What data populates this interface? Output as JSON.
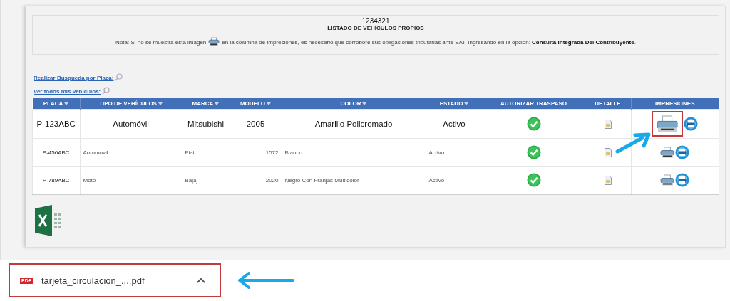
{
  "header": {
    "code": "1234321",
    "title": "LISTADO DE VEHÍCULOS PROPIOS",
    "note_before": "Nota: Si no se muestra esta imagen",
    "note_after": "en la columna de impresiones, es necesario que corrobore sus obligaciones tributarias ante SAT, ingresando en la opción: **Consulta Integrada Del Contribuyente**."
  },
  "links": [
    "Realizar Busqueda por Placa:",
    "Ver todos mis vehículos:"
  ],
  "table": {
    "columns": [
      {
        "label": "PLACA",
        "sortable": true
      },
      {
        "label": "TIPO DE VEHÍCULOS",
        "sortable": true
      },
      {
        "label": "MARCA",
        "sortable": true
      },
      {
        "label": "MODELO",
        "sortable": true
      },
      {
        "label": "COLOR",
        "sortable": true
      },
      {
        "label": "ESTADO",
        "sortable": true
      },
      {
        "label": "AUTORIZAR TRASPASO",
        "sortable": false
      },
      {
        "label": "DETALLE",
        "sortable": false
      },
      {
        "label": "IMPRESIONES",
        "sortable": false
      }
    ],
    "rows": [
      {
        "kind": "large",
        "placa": "P-123ABC",
        "tipo": "Automóvil",
        "marca": "Mitsubishi",
        "modelo": "2005",
        "color_name": "Amarillo Policromado",
        "estado": "Activo",
        "authorized": true,
        "print_highlighted": true
      },
      {
        "kind": "normal",
        "placa": "P-456ABC",
        "tipo": "Automovil",
        "marca": "Fiat",
        "modelo": "1572",
        "color_name": "Blanco",
        "estado": "Activo",
        "authorized": true,
        "print_highlighted": false
      },
      {
        "kind": "normal",
        "placa": "P-789ABC",
        "tipo": "Moto",
        "marca": "Bajaj",
        "modelo": "2020",
        "color_name": "Negro Con Franjas Multicolor",
        "estado": "Activo",
        "authorized": true,
        "print_highlighted": false
      }
    ]
  },
  "download_bar": {
    "file": "tarjeta_circulacion_....pdf",
    "file_type": "PDF",
    "highlighted": true
  }
}
